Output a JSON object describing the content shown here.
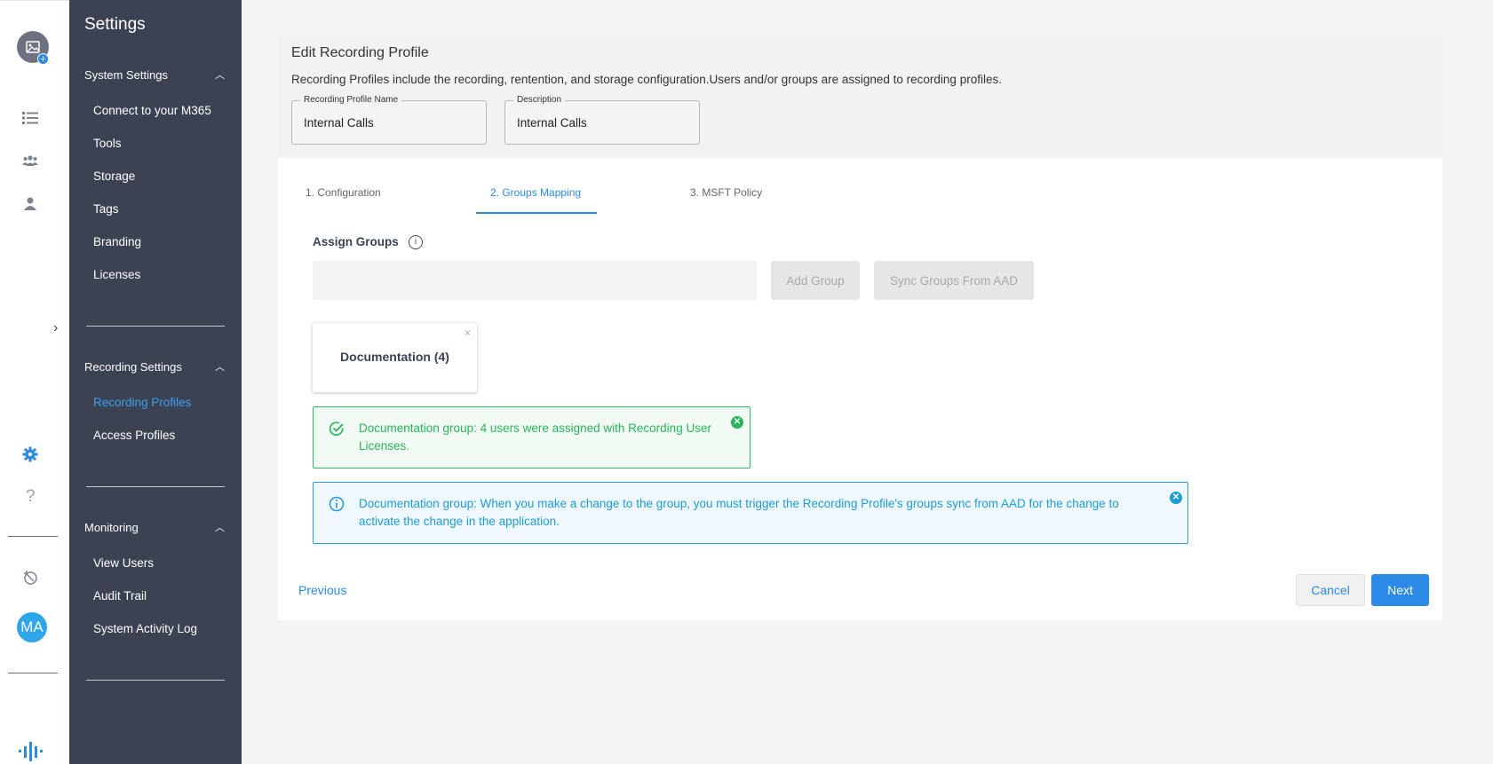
{
  "rail": {
    "avatar_initials": "MA",
    "icons": [
      "image-avatar-icon",
      "list-icon",
      "group-icon",
      "person-icon",
      "gear-icon",
      "help-icon",
      "history-icon",
      "logo-icon"
    ],
    "help_glyph": "?",
    "expand_glyph": "›",
    "accent": "#2b8ae5"
  },
  "sidebar": {
    "title": "Settings",
    "sections": [
      {
        "label": "System Settings",
        "items": [
          "Connect to your M365",
          "Tools",
          "Storage",
          "Tags",
          "Branding",
          "Licenses"
        ]
      },
      {
        "label": "Recording Settings",
        "items": [
          "Recording Profiles",
          "Access Profiles"
        ]
      },
      {
        "label": "Monitoring",
        "items": [
          "View Users",
          "Audit Trail",
          "System Activity Log"
        ]
      }
    ],
    "active_item": "Recording Profiles",
    "bg_color": "#3b4252",
    "active_color": "#3aa0ee"
  },
  "page": {
    "title": "Edit Recording Profile",
    "description": "Recording Profiles include the recording, rentention, and storage configuration.Users and/or groups are assigned to recording profiles.",
    "fields": [
      {
        "label": "Recording Profile Name",
        "value": "Internal Calls"
      },
      {
        "label": "Description",
        "value": "Internal Calls"
      }
    ]
  },
  "tabs": [
    {
      "label": "1. Configuration",
      "active": false
    },
    {
      "label": "2. Groups Mapping",
      "active": true
    },
    {
      "label": "3. MSFT Policy",
      "active": false
    }
  ],
  "assign": {
    "label": "Assign Groups",
    "search_value": "",
    "add_button": "Add Group",
    "sync_button": "Sync Groups From AAD",
    "group_chip": "Documentation (4)",
    "chip_close": "×"
  },
  "alerts": {
    "success": {
      "line1": "Documentation group: 4 users were assigned with Recording User",
      "line2": "Licenses.",
      "color": "#28b45b"
    },
    "info": {
      "line1": "Documentation group: When you make a change to the group, you must trigger the Recording Profile's groups sync from AAD for the change to",
      "line2": "activate the change in the application.",
      "color": "#1f9bd6"
    }
  },
  "footer": {
    "previous": "Previous",
    "cancel": "Cancel",
    "next": "Next"
  }
}
